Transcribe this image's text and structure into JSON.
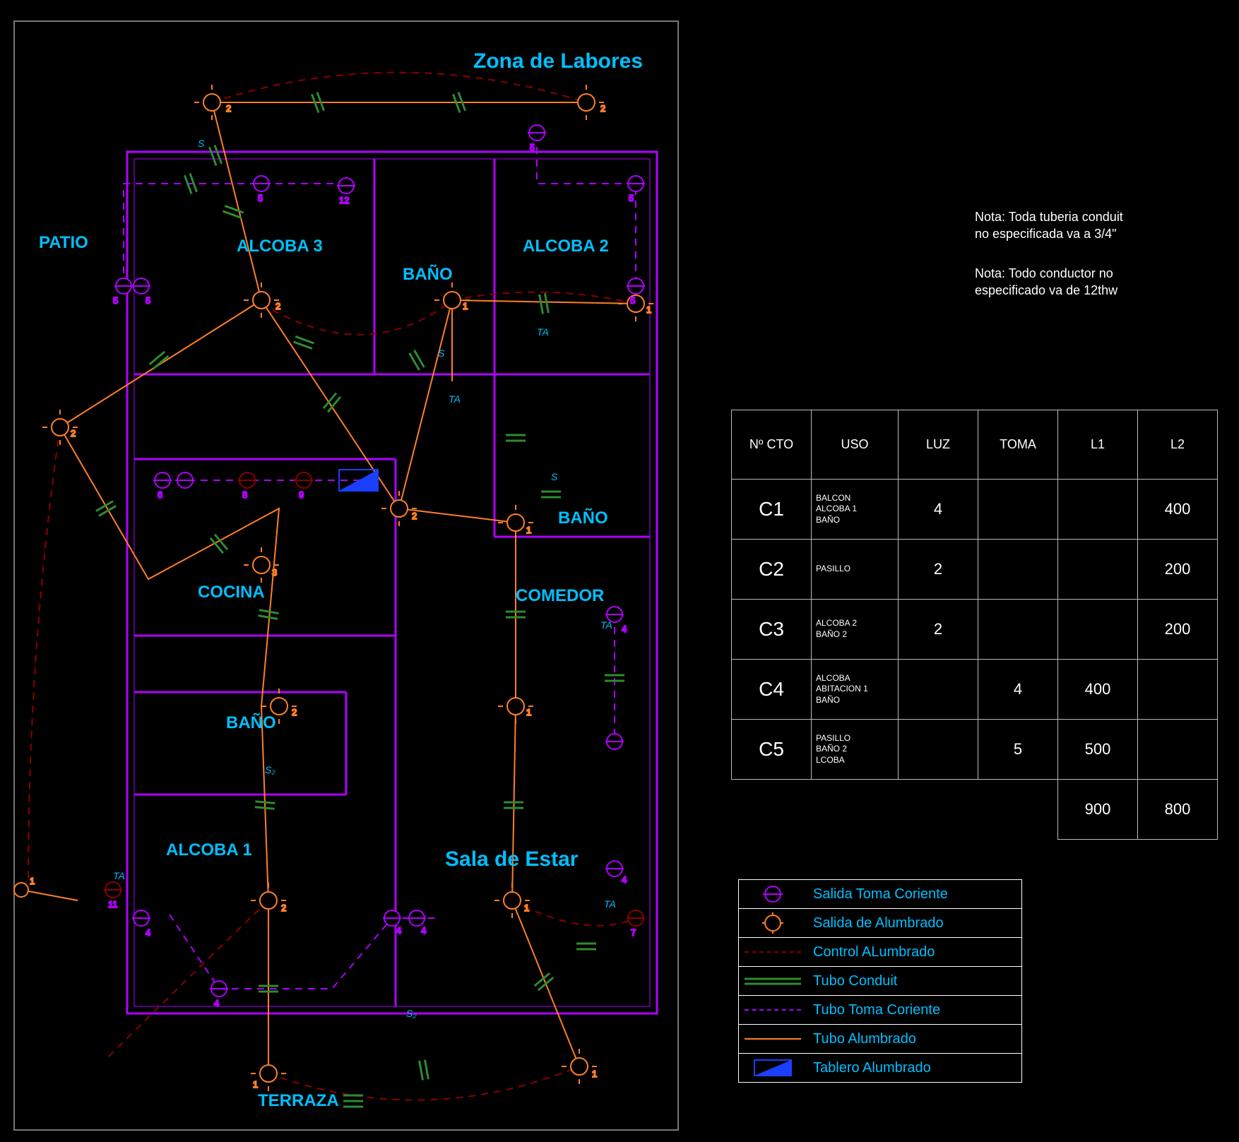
{
  "rooms": {
    "zona": "Zona de Labores",
    "patio": "PATIO",
    "alcoba3": "ALCOBA 3",
    "bano1": "BAÑO",
    "alcoba2": "ALCOBA 2",
    "cocina": "COCINA",
    "bano2": "BAÑO",
    "comedor": "COMEDOR",
    "bano3": "BAÑO",
    "alcoba1": "ALCOBA 1",
    "sala": "Sala de Estar",
    "terraza": "TERRAZA"
  },
  "notes": {
    "n1a": "Nota: Toda tuberia conduit",
    "n1b": "no especificada va a 3/4\"",
    "n2a": "Nota: Todo conductor no",
    "n2b": "especificado va de 12thw"
  },
  "circuit_table": {
    "headers": [
      "Nº CTO",
      "USO",
      "LUZ",
      "TOMA",
      "L1",
      "L2"
    ],
    "rows": [
      {
        "id": "C1",
        "uso": "BALCON\nALCOBA 1\nBAÑO",
        "luz": "4",
        "toma": "",
        "l1": "",
        "l2": "400"
      },
      {
        "id": "C2",
        "uso": "PASILLO",
        "luz": "2",
        "toma": "",
        "l1": "",
        "l2": "200"
      },
      {
        "id": "C3",
        "uso": "ALCOBA 2\nBAÑO 2",
        "luz": "2",
        "toma": "",
        "l1": "",
        "l2": "200"
      },
      {
        "id": "C4",
        "uso": "ALCOBA\nABITACION 1\nBAÑO",
        "luz": "",
        "toma": "4",
        "l1": "400",
        "l2": ""
      },
      {
        "id": "C5",
        "uso": "PASILLO\nBAÑO 2\nLCOBA",
        "luz": "",
        "toma": "5",
        "l1": "500",
        "l2": ""
      }
    ],
    "totals": {
      "l1": "900",
      "l2": "800"
    }
  },
  "legend": {
    "toma": "Salida Toma Coriente",
    "alumbrado": "Salida de Alumbrado",
    "control": "Control ALumbrado",
    "conduit": "Tubo Conduit",
    "ttoma": "Tubo Toma Coriente",
    "talumbrado": "Tubo Alumbrado",
    "tablero": "Tablero Alumbrado"
  },
  "colors": {
    "cyan": "#00bfff",
    "orange": "#ff7f27",
    "magenta": "#b000ff",
    "red": "#b00000",
    "green": "#2e8b2e",
    "blue": "#1a3fff",
    "grey": "#888"
  }
}
